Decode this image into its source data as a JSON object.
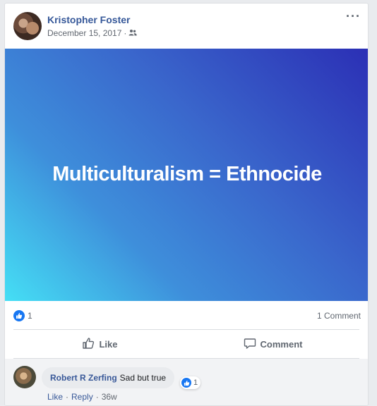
{
  "post": {
    "author": "Kristopher Foster",
    "date": "December 15, 2017",
    "separator": "·",
    "audience_icon": "friends-icon",
    "more_label": "···"
  },
  "banner": {
    "text": "Multiculturalism = Ethnocide",
    "colors": [
      "#2b2fb5",
      "#3e8fdb",
      "#45dff5"
    ]
  },
  "stats": {
    "like_count": "1",
    "comment_count": "1 Comment"
  },
  "actions": {
    "like_label": "Like",
    "comment_label": "Comment"
  },
  "comment": {
    "author": "Robert R Zerfing",
    "text": "Sad but true",
    "reaction_count": "1",
    "like_label": "Like",
    "reply_label": "Reply",
    "separator": "·",
    "age": "36w"
  },
  "colors": {
    "link": "#365899",
    "like_blue": "#1877f2",
    "muted": "#606770"
  }
}
